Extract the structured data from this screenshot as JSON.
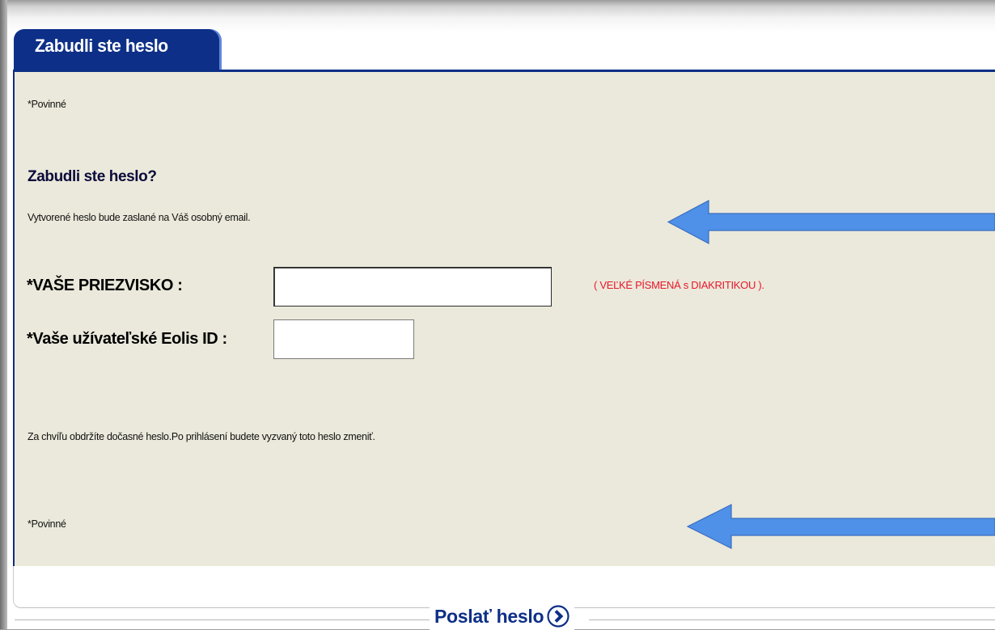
{
  "tab": {
    "title": "Zabudli ste heslo"
  },
  "form": {
    "required_top": "*Povinné",
    "heading": "Zabudli ste heslo?",
    "intro": "Vytvorené heslo bude zaslané na Váš osobný email.",
    "surname_label": "*VAŠE PRIEZVISKO :",
    "surname_value": "",
    "surname_hint": "( VEĽKÉ PÍSMENÁ s DIAKRITIKOU ).",
    "eolis_label": "*Vaše užívateľské Eolis ID :",
    "eolis_value": "",
    "info": "Za chvíľu obdržíte dočasné heslo.Po prihlásení budete vyzvaný toto heslo zmeniť.",
    "required_bottom": "*Povinné"
  },
  "footer": {
    "send_label": "Poslať  heslo",
    "send_icon": "chevron-right-circle-icon"
  },
  "annotations": {
    "arrow_icon": "left-arrow-icon",
    "arrow_color": "#4f90e8"
  },
  "colors": {
    "tab": "#0d2f87",
    "panel": "#ebe9db",
    "hint": "#e8182b",
    "button_text": "#0d2f87"
  }
}
